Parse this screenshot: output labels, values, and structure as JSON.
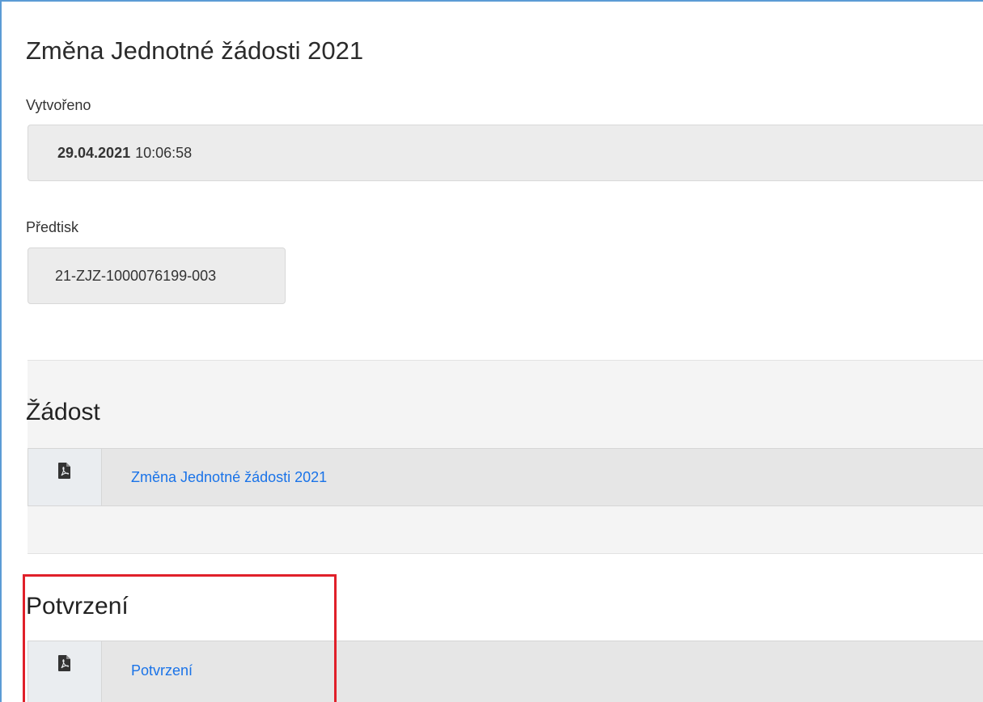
{
  "page": {
    "title": "Změna Jednotné žádosti 2021"
  },
  "created": {
    "label": "Vytvořeno",
    "date": "29.04.2021",
    "time": "10:06:58"
  },
  "predtisk": {
    "label": "Předtisk",
    "value": "21-ZJZ-1000076199-003"
  },
  "zadost": {
    "heading": "Žádost",
    "document": {
      "icon": "pdf-file-icon",
      "link_label": "Změna Jednotné žádosti 2021"
    }
  },
  "potvrzeni": {
    "heading": "Potvrzení",
    "document": {
      "icon": "pdf-file-icon",
      "link_label": "Potvrzení"
    }
  },
  "colors": {
    "link": "#1a73e8",
    "highlight": "#e0202a",
    "frame": "#5b9bd5"
  }
}
